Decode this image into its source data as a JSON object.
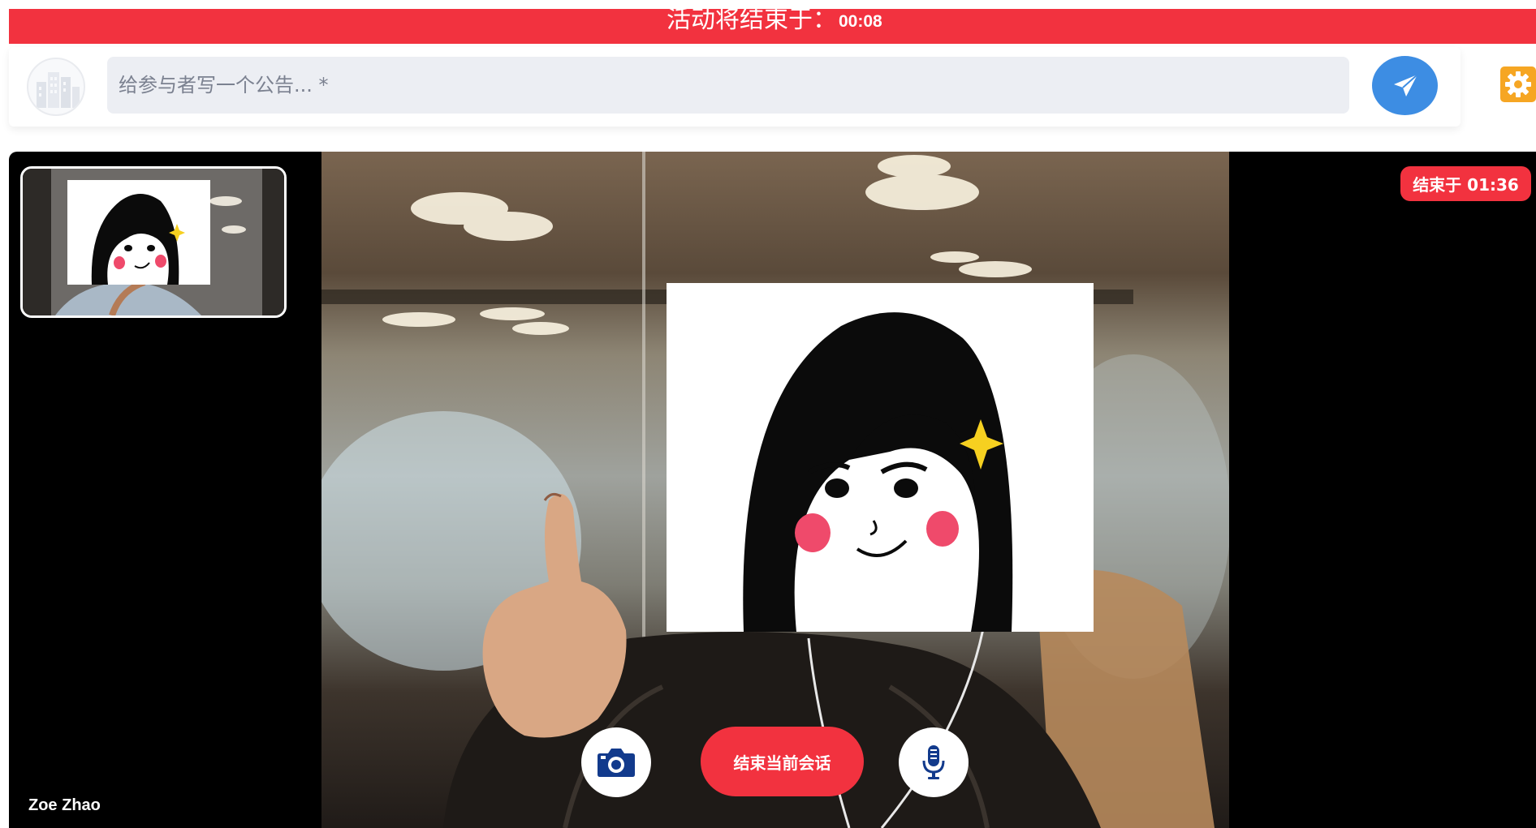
{
  "banner": {
    "label": "活动将结束于：",
    "countdown": "00:08",
    "color": "#f2323f"
  },
  "announcement": {
    "placeholder": "给参与者写一个公告... *",
    "value": "",
    "send_icon": "paper-plane-icon",
    "settings_icon": "gear-icon",
    "logo_icon": "building-logo-icon"
  },
  "video": {
    "participant_name": "Zoe Zhao",
    "ends_badge": "结束于 01:36",
    "end_session_label": "结束当前会话",
    "camera_icon": "camera-icon",
    "mic_icon": "microphone-icon"
  },
  "colors": {
    "accent_red": "#f2323f",
    "send_blue": "#3d8de3",
    "settings_orange": "#f6a623"
  }
}
